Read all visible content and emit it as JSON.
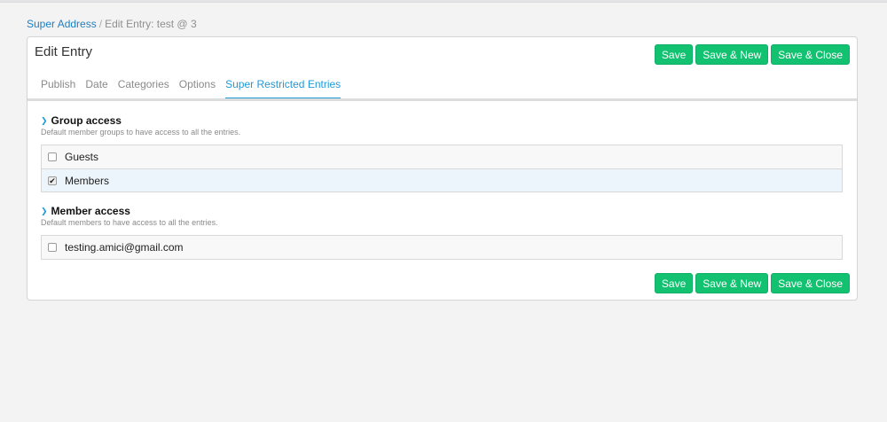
{
  "breadcrumb": {
    "link": "Super Address",
    "separator": "/",
    "current": "Edit Entry: test @ 3"
  },
  "panel": {
    "title": "Edit Entry"
  },
  "buttons": {
    "save": "Save",
    "save_new": "Save & New",
    "save_close": "Save & Close"
  },
  "tabs": [
    {
      "label": "Publish",
      "active": false
    },
    {
      "label": "Date",
      "active": false
    },
    {
      "label": "Categories",
      "active": false
    },
    {
      "label": "Options",
      "active": false
    },
    {
      "label": "Super Restricted Entries",
      "active": true
    }
  ],
  "group_access": {
    "title": "Group access",
    "description": "Default member groups to have access to all the entries.",
    "items": [
      {
        "label": "Guests",
        "checked": false
      },
      {
        "label": "Members",
        "checked": true
      }
    ]
  },
  "member_access": {
    "title": "Member access",
    "description": "Default members to have access to all the entries.",
    "items": [
      {
        "label": "testing.amici@gmail.com",
        "checked": false
      }
    ]
  },
  "colors": {
    "accent": "#1f9ad6",
    "button": "#12c270",
    "background": "#f3f3f4"
  }
}
